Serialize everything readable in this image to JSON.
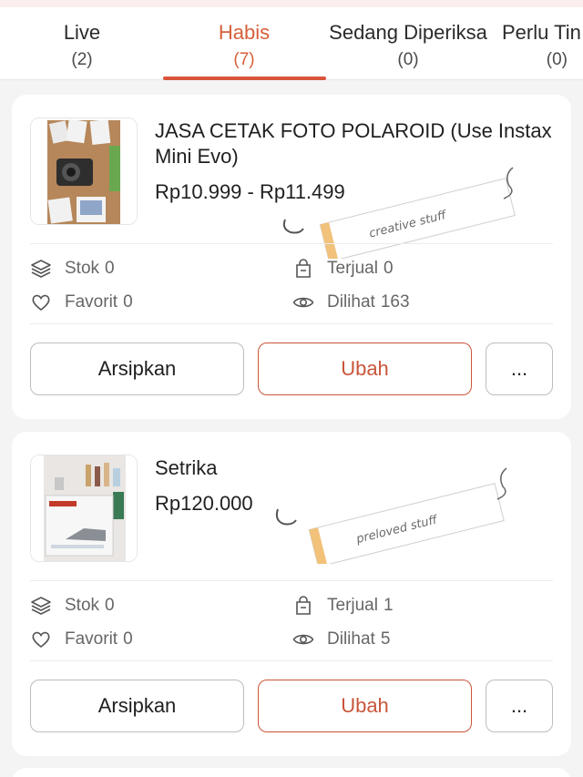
{
  "tabs": [
    {
      "label": "Live",
      "count": "(2)"
    },
    {
      "label": "Habis",
      "count": "(7)",
      "active": true
    },
    {
      "label": "Sedang Diperiksa",
      "count": "(0)"
    },
    {
      "label": "Perlu Tin",
      "count": "(0)"
    }
  ],
  "products": [
    {
      "title": "JASA CETAK FOTO POLAROID (Use Instax Mini Evo)",
      "price": "Rp10.999 - Rp11.499",
      "sticker": "creative stuff",
      "stats": {
        "stok_label": "Stok",
        "stok": "0",
        "terjual_label": "Terjual",
        "terjual": "0",
        "favorit_label": "Favorit",
        "favorit": "0",
        "dilihat_label": "Dilihat",
        "dilihat": "163"
      },
      "buttons": {
        "archive": "Arsipkan",
        "edit": "Ubah",
        "more": "..."
      }
    },
    {
      "title": "Setrika",
      "price": "Rp120.000",
      "sticker": "preloved stuff",
      "stats": {
        "stok_label": "Stok",
        "stok": "0",
        "terjual_label": "Terjual",
        "terjual": "1",
        "favorit_label": "Favorit",
        "favorit": "0",
        "dilihat_label": "Dilihat",
        "dilihat": "5"
      },
      "buttons": {
        "archive": "Arsipkan",
        "edit": "Ubah",
        "more": "..."
      }
    }
  ],
  "icons": {
    "stok": "layers-icon",
    "terjual": "shopping-bag-icon",
    "favorit": "heart-icon",
    "dilihat": "eye-icon"
  },
  "colors": {
    "accent": "#d8553a",
    "button_border": "#bdbdbd",
    "background": "#f4f4f4"
  }
}
